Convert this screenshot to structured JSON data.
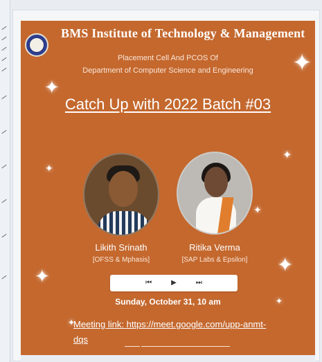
{
  "poster": {
    "institute": "BMS Institute of Technology & Management",
    "subtitle_line1": "Placement Cell And PCOS Of",
    "subtitle_line2": "Department of Computer Science and Engineering",
    "event_title": "Catch Up with 2022 Batch #03",
    "speakers": [
      {
        "name": "Likith Srinath",
        "org": "[OFSS & Mphasis]"
      },
      {
        "name": "Ritika Verma",
        "org": "[SAP Labs & Epsilon]"
      }
    ],
    "date_time": "Sunday, October 31, 10 am",
    "meeting_label": "Meeting link: https://meet.google.com/upp-anmt-",
    "meeting_label_cont": "dqs"
  },
  "player": {
    "prev_icon": "⏮",
    "play_icon": "▶",
    "next_icon": "⏭"
  },
  "colors": {
    "poster_bg": "#c4682e",
    "text": "#ffffff",
    "logo_bg": "#2f3f8f"
  },
  "icons": {
    "sparkle": "sparkle-icon",
    "logo": "college-seal-icon"
  }
}
